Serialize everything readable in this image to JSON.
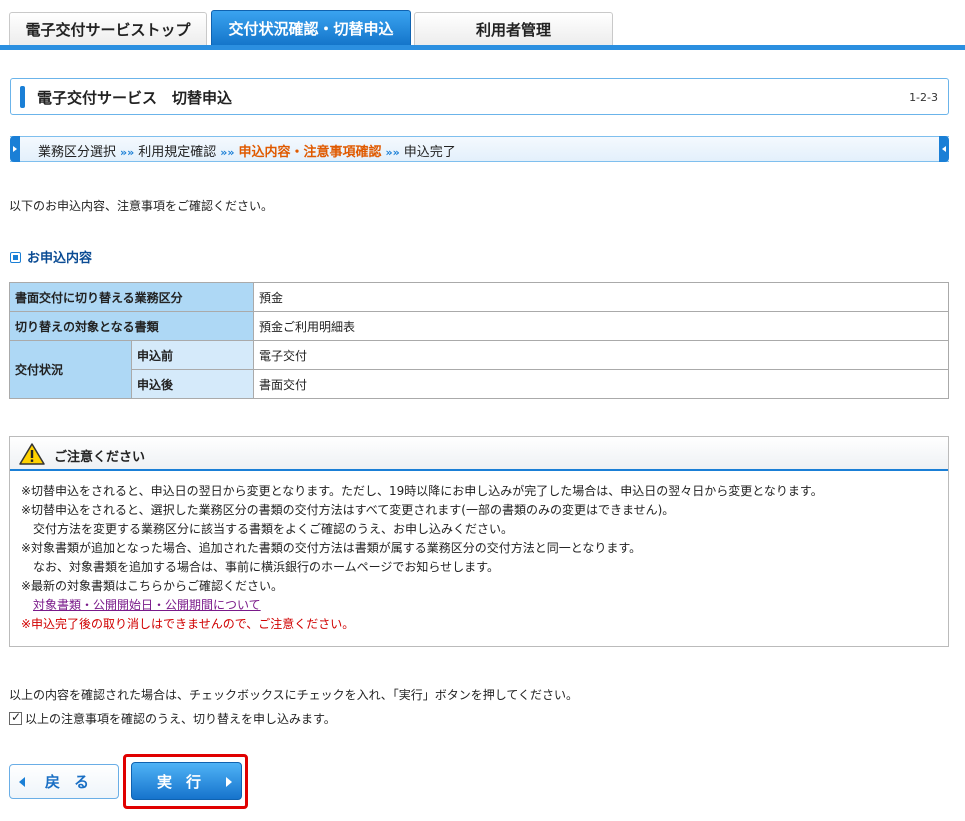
{
  "tabs": [
    {
      "label": "電子交付サービストップ",
      "active": false
    },
    {
      "label": "交付状況確認・切替申込",
      "active": true
    },
    {
      "label": "利用者管理",
      "active": false
    }
  ],
  "page": {
    "title": "電子交付サービス　切替申込",
    "code": "1-2-3"
  },
  "steps": [
    {
      "label": "業務区分選択",
      "current": false
    },
    {
      "label": "利用規定確認",
      "current": false
    },
    {
      "label": "申込内容・注意事項確認",
      "current": true
    },
    {
      "label": "申込完了",
      "current": false
    }
  ],
  "intro": "以下のお申込内容、注意事項をご確認ください。",
  "section_title": "お申込内容",
  "table": {
    "row1_label": "書面交付に切り替える業務区分",
    "row1_value": "預金",
    "row2_label": "切り替えの対象となる書類",
    "row2_value": "預金ご利用明細表",
    "status_label": "交付状況",
    "before_label": "申込前",
    "before_value": "電子交付",
    "after_label": "申込後",
    "after_value": "書面交付"
  },
  "notice": {
    "title": "ご注意ください",
    "line1": "※切替申込をされると、申込日の翌日から変更となります。ただし、19時以降にお申し込みが完了した場合は、申込日の翌々日から変更となります。",
    "line2": "※切替申込をされると、選択した業務区分の書類の交付方法はすべて変更されます(一部の書類のみの変更はできません)。",
    "line3": "交付方法を変更する業務区分に該当する書類をよくご確認のうえ、お申し込みください。",
    "line4": "※対象書類が追加となった場合、追加された書類の交付方法は書類が属する業務区分の交付方法と同一となります。",
    "line5": "なお、対象書類を追加する場合は、事前に横浜銀行のホームページでお知らせします。",
    "line6": "※最新の対象書類はこちらからご確認ください。",
    "link": "対象書類・公開開始日・公開期間について",
    "warning": "※申込完了後の取り消しはできませんので、ご注意ください。"
  },
  "confirm_text": "以上の内容を確認された場合は、チェックボックスにチェックを入れ、「実行」ボタンを押してください。",
  "checkbox_label": "以上の注意事項を確認のうえ、切り替えを申し込みます。",
  "checkbox_checked": true,
  "buttons": {
    "back": "戻る",
    "execute": "実行"
  },
  "colors": {
    "accent": "#1a7fd6",
    "current_step": "#e05a00",
    "warning_text": "#d00000",
    "highlight": "#e00000"
  }
}
